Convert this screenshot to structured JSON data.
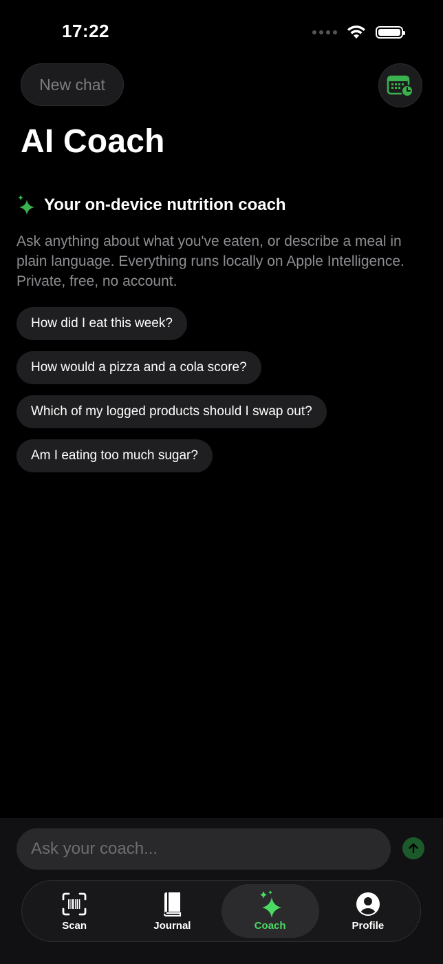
{
  "status_bar": {
    "time": "17:22"
  },
  "header": {
    "new_chat_label": "New chat",
    "title": "AI Coach",
    "history_icon": "calendar-clock-icon"
  },
  "intro": {
    "heading": "Your on-device nutrition coach",
    "body": "Ask anything about what you've eaten, or describe a meal in plain language. Everything runs locally on Apple Intelligence. Private, free, no account."
  },
  "suggestions": [
    "How did I eat this week?",
    "How would a pizza and a cola score?",
    "Which of my logged products should I swap out?",
    "Am I eating too much sugar?"
  ],
  "composer": {
    "placeholder": "Ask your coach..."
  },
  "tabs": [
    {
      "label": "Scan",
      "icon": "barcode-scan-icon",
      "active": false
    },
    {
      "label": "Journal",
      "icon": "book-icon",
      "active": false
    },
    {
      "label": "Coach",
      "icon": "sparkles-icon",
      "active": true
    },
    {
      "label": "Profile",
      "icon": "person-circle-icon",
      "active": false
    }
  ],
  "colors": {
    "accent": "#4cd964",
    "background": "#000000",
    "chip": "#1f1f21",
    "muted_text": "#8e8e93"
  }
}
